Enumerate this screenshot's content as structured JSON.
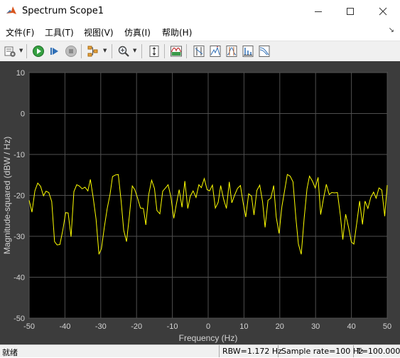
{
  "window": {
    "title": "Spectrum Scope1",
    "minimize_glyph": "—",
    "maximize_glyph": "☐",
    "close_glyph": "✕"
  },
  "menu": {
    "items": [
      "文件(F)",
      "工具(T)",
      "视图(V)",
      "仿真(I)",
      "帮助(H)"
    ],
    "pin_glyph": "↘"
  },
  "toolbar": {
    "buttons": [
      "settings-icon",
      "run-icon",
      "step-forward-icon",
      "stop-icon",
      "signal-selector-icon",
      "zoom-icon",
      "autoscale-icon",
      "spectrum-icon",
      "cursor-measurements-icon",
      "peak-finder-icon",
      "channel-measurements-icon",
      "distortion-measurements-icon",
      "ccdf-icon"
    ]
  },
  "status": {
    "ready": "就绪",
    "rbw": "RBW=1.172 Hz",
    "sample_rate": "Sample rate=100 Hz",
    "time": "T=100.000"
  },
  "chart_data": {
    "type": "line",
    "xlabel": "Frequency (Hz)",
    "ylabel": "Magnitude-squared (dBW / Hz)",
    "xlim": [
      -50,
      50
    ],
    "ylim": [
      -50,
      10
    ],
    "xticks": [
      -50,
      -40,
      -30,
      -20,
      -10,
      0,
      10,
      20,
      30,
      40,
      50
    ],
    "yticks": [
      10,
      0,
      -10,
      -20,
      -30,
      -40,
      -50
    ],
    "grid": true,
    "colors": {
      "background": "#000000",
      "line": "#ffff00",
      "grid": "#4f4f4f",
      "axes_text": "#d4d4d4",
      "figure": "#3c3c3c"
    },
    "series": [
      {
        "x": [
          -50,
          -49.2,
          -48.4,
          -47.6,
          -46.8,
          -46,
          -45.3,
          -44.5,
          -43.7,
          -42.9,
          -42.2,
          -41.4,
          -40.6,
          -39.8,
          -39.1,
          -38.3,
          -37.5,
          -36.7,
          -36,
          -35.2,
          -34.4,
          -33.6,
          -32.9,
          -32.1,
          -31.3,
          -30.5,
          -29.8,
          -29,
          -28.2,
          -27.4,
          -26.7,
          -25.9,
          -25.1,
          -24.3,
          -23.6,
          -22.8,
          -22,
          -21.2,
          -20.5,
          -19.7,
          -18.9,
          -18.1,
          -17.4,
          -16.6,
          -15.8,
          -15,
          -14.3,
          -13.5,
          -12.7,
          -11.9,
          -11.2,
          -10.4,
          -9.6,
          -8.8,
          -8.1,
          -7.3,
          -6.5,
          -5.7,
          -5,
          -4.2,
          -3.4,
          -2.6,
          -1.9,
          -1.1,
          -0.3,
          0.4,
          1.2,
          2,
          2.8,
          3.5,
          4.3,
          5.1,
          5.9,
          6.6,
          7.4,
          8.2,
          9,
          9.7,
          10.5,
          11.3,
          12.1,
          12.8,
          13.6,
          14.4,
          15.2,
          15.9,
          16.7,
          17.5,
          18.3,
          19,
          19.8,
          20.6,
          21.4,
          22.1,
          22.9,
          23.7,
          24.5,
          25.2,
          26,
          26.8,
          27.6,
          28.3,
          29.1,
          29.9,
          30.7,
          31.4,
          32.2,
          33,
          33.8,
          34.5,
          35.3,
          36.1,
          36.9,
          37.6,
          38.4,
          39.2,
          40,
          40.7,
          41.5,
          42.3,
          43.1,
          43.8,
          44.6,
          45.4,
          46.2,
          46.9,
          47.7,
          48.5,
          49.3,
          50
        ],
        "y": [
          -21.2,
          -24.1,
          -18.9,
          -17.0,
          -17.8,
          -20.1,
          -19.0,
          -19.3,
          -21.5,
          -31.3,
          -32.1,
          -32.0,
          -28.5,
          -24.2,
          -24.3,
          -30.1,
          -19.1,
          -17.4,
          -17.7,
          -18.4,
          -18.0,
          -18.9,
          -16.1,
          -20.6,
          -25.8,
          -34.4,
          -33.0,
          -27.8,
          -23.2,
          -19.7,
          -15.4,
          -15.0,
          -14.9,
          -21.4,
          -28.5,
          -31.3,
          -25.0,
          -17.7,
          -18.6,
          -20.7,
          -23.1,
          -23.2,
          -27.2,
          -19.8,
          -16.3,
          -18.3,
          -23.7,
          -24.5,
          -19.0,
          -18.2,
          -17.4,
          -20.4,
          -25.6,
          -21.8,
          -18.6,
          -22.9,
          -16.5,
          -23.2,
          -20.2,
          -18.9,
          -20.5,
          -17.4,
          -18.1,
          -15.9,
          -18.6,
          -18.9,
          -17.5,
          -23.1,
          -21.7,
          -17.6,
          -20.9,
          -23.2,
          -16.7,
          -21.8,
          -19.9,
          -18.3,
          -17.6,
          -21.5,
          -25.3,
          -19.6,
          -20.2,
          -24.8,
          -18.8,
          -17.5,
          -21.6,
          -27.8,
          -21.2,
          -20.7,
          -17.6,
          -25.3,
          -29.3,
          -22.7,
          -18.5,
          -14.9,
          -15.3,
          -16.7,
          -25.6,
          -31.9,
          -34.4,
          -25.6,
          -18.4,
          -15.3,
          -16.5,
          -18.2,
          -15.6,
          -24.7,
          -20.8,
          -17.3,
          -19.8,
          -19.3,
          -19.4,
          -19.3,
          -24.8,
          -30.8,
          -24.6,
          -27.8,
          -31.4,
          -31.9,
          -26.7,
          -21.4,
          -27.1,
          -21.4,
          -23.2,
          -20.5,
          -19.2,
          -20.7,
          -18.2,
          -18.7,
          -25.1,
          -17.5
        ]
      }
    ]
  }
}
